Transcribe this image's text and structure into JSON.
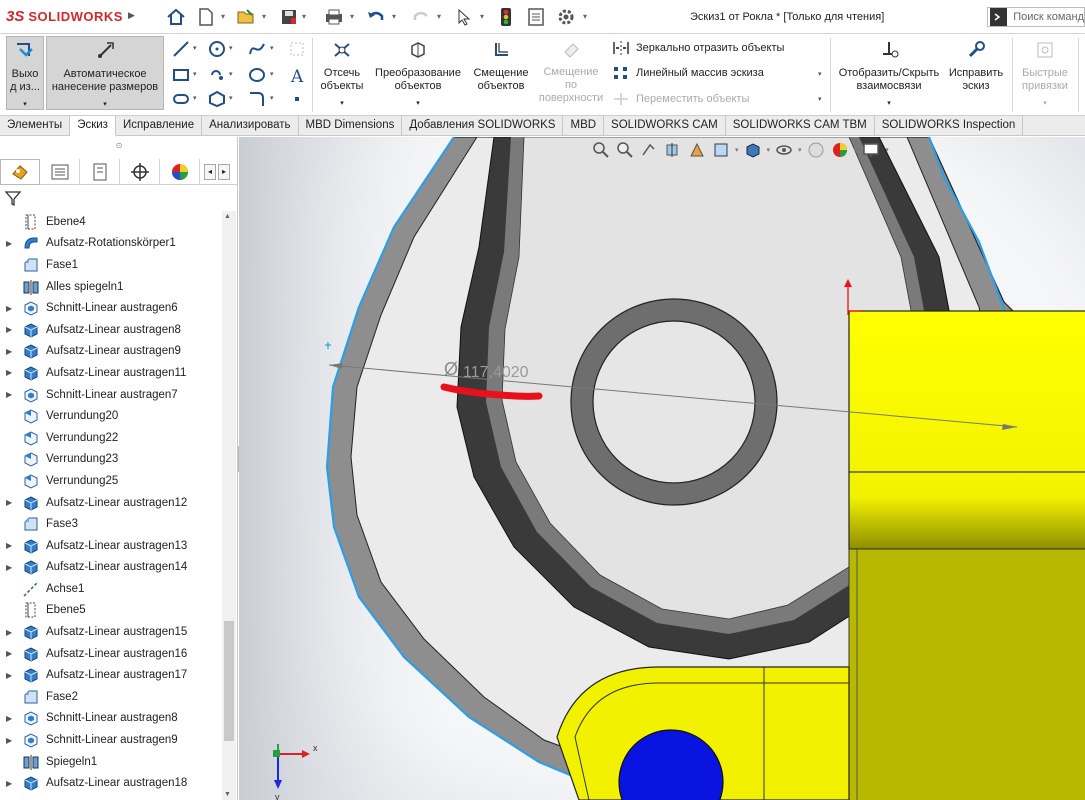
{
  "app": {
    "logo_text": "SOLIDWORKS",
    "logo_mark": "3S",
    "document_title": "Эскиз1 от Рокла * [Только для чтения]",
    "search_placeholder": "Поиск команд"
  },
  "ribbon": {
    "exit_sketch": "Выхо\nд из...",
    "auto_dimension": "Автоматическое\nнанесение размеров",
    "trim": "Отсечь\nобъекты",
    "convert": "Преобразование\nобъектов",
    "offset": "Смещение\nобъектов",
    "offset_surface": "Смещение\nпо\nповерхности",
    "mirror": "Зеркально отразить объекты",
    "linear_pattern": "Линейный массив эскиза",
    "move": "Переместить объекты",
    "display_relations": "Отобразить/Скрыть\nвзаимосвязи",
    "repair_sketch": "Исправить\nэскиз",
    "quick_snaps": "Быстрые\nпривязки"
  },
  "tabs": [
    {
      "label": "Элементы",
      "active": false
    },
    {
      "label": "Эскиз",
      "active": true
    },
    {
      "label": "Исправление",
      "active": false
    },
    {
      "label": "Анализировать",
      "active": false
    },
    {
      "label": "MBD Dimensions",
      "active": false
    },
    {
      "label": "Добавления SOLIDWORKS",
      "active": false
    },
    {
      "label": "MBD",
      "active": false
    },
    {
      "label": "SOLIDWORKS CAM",
      "active": false
    },
    {
      "label": "SOLIDWORKS CAM TBM",
      "active": false
    },
    {
      "label": "SOLIDWORKS Inspection",
      "active": false
    }
  ],
  "tree": [
    {
      "label": "Ebene4",
      "icon": "plane",
      "expandable": false
    },
    {
      "label": "Aufsatz-Rotationskörper1",
      "icon": "revolve",
      "expandable": true
    },
    {
      "label": "Fase1",
      "icon": "chamfer",
      "expandable": false
    },
    {
      "label": "Alles spiegeln1",
      "icon": "mirror",
      "expandable": false
    },
    {
      "label": "Schnitt-Linear austragen6",
      "icon": "cut",
      "expandable": true
    },
    {
      "label": "Aufsatz-Linear austragen8",
      "icon": "extrude",
      "expandable": true
    },
    {
      "label": "Aufsatz-Linear austragen9",
      "icon": "extrude",
      "expandable": true
    },
    {
      "label": "Aufsatz-Linear austragen11",
      "icon": "extrude",
      "expandable": true
    },
    {
      "label": "Schnitt-Linear austragen7",
      "icon": "cut",
      "expandable": true
    },
    {
      "label": "Verrundung20",
      "icon": "fillet",
      "expandable": false
    },
    {
      "label": "Verrundung22",
      "icon": "fillet",
      "expandable": false
    },
    {
      "label": "Verrundung23",
      "icon": "fillet",
      "expandable": false
    },
    {
      "label": "Verrundung25",
      "icon": "fillet",
      "expandable": false
    },
    {
      "label": "Aufsatz-Linear austragen12",
      "icon": "extrude",
      "expandable": true
    },
    {
      "label": "Fase3",
      "icon": "chamfer",
      "expandable": false
    },
    {
      "label": "Aufsatz-Linear austragen13",
      "icon": "extrude",
      "expandable": true
    },
    {
      "label": "Aufsatz-Linear austragen14",
      "icon": "extrude",
      "expandable": true
    },
    {
      "label": "Achse1",
      "icon": "axis",
      "expandable": false
    },
    {
      "label": "Ebene5",
      "icon": "plane",
      "expandable": false
    },
    {
      "label": "Aufsatz-Linear austragen15",
      "icon": "extrude",
      "expandable": true
    },
    {
      "label": "Aufsatz-Linear austragen16",
      "icon": "extrude",
      "expandable": true
    },
    {
      "label": "Aufsatz-Linear austragen17",
      "icon": "extrude",
      "expandable": true
    },
    {
      "label": "Fase2",
      "icon": "chamfer",
      "expandable": false
    },
    {
      "label": "Schnitt-Linear austragen8",
      "icon": "cut",
      "expandable": true
    },
    {
      "label": "Schnitt-Linear austragen9",
      "icon": "cut",
      "expandable": true
    },
    {
      "label": "Spiegeln1",
      "icon": "mirror",
      "expandable": false
    },
    {
      "label": "Aufsatz-Linear austragen18",
      "icon": "extrude",
      "expandable": true
    }
  ],
  "viewport": {
    "dimension_symbol": "Ø",
    "dimension_value": "117,4020",
    "triad_x": "x",
    "triad_y": "y",
    "colors": {
      "yellow": "#f2f200",
      "yellow_dark": "#b8b800",
      "blue_fill": "#0a14e0",
      "sketch_blue": "#2a9fe8",
      "annotation_red": "#e8101a"
    }
  }
}
